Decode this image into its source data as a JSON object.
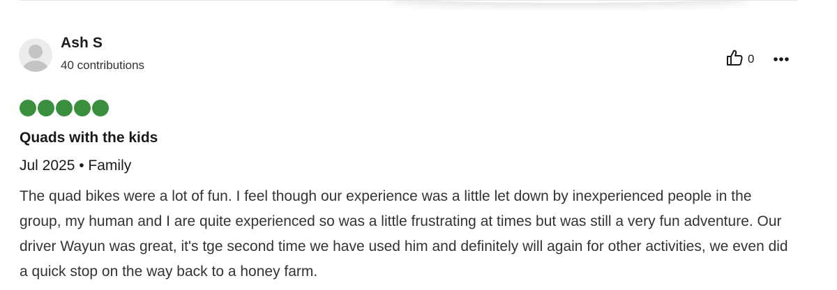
{
  "review": {
    "user": {
      "name": "Ash S",
      "contributions": "40 contributions"
    },
    "helpful_count": "0",
    "icons": {
      "avatar": "default-avatar-icon",
      "helpful": "thumbs-up-icon",
      "more": "more-options-icon"
    },
    "rating": {
      "value": 5,
      "max": 5,
      "color": "#3a8f3f"
    },
    "title": "Quads with the kids",
    "meta": "Jul 2025 • Family",
    "body": "The quad bikes were a lot of fun. I feel though our experience was a little let down by inexperienced people in the group, my human and I are quite experienced so was a little frustrating at times but was still a very fun adventure. Our driver Wayun was great, it's tge second time we have used him and definitely will again for other activities, we even did a quick stop on the way back to a honey farm."
  }
}
